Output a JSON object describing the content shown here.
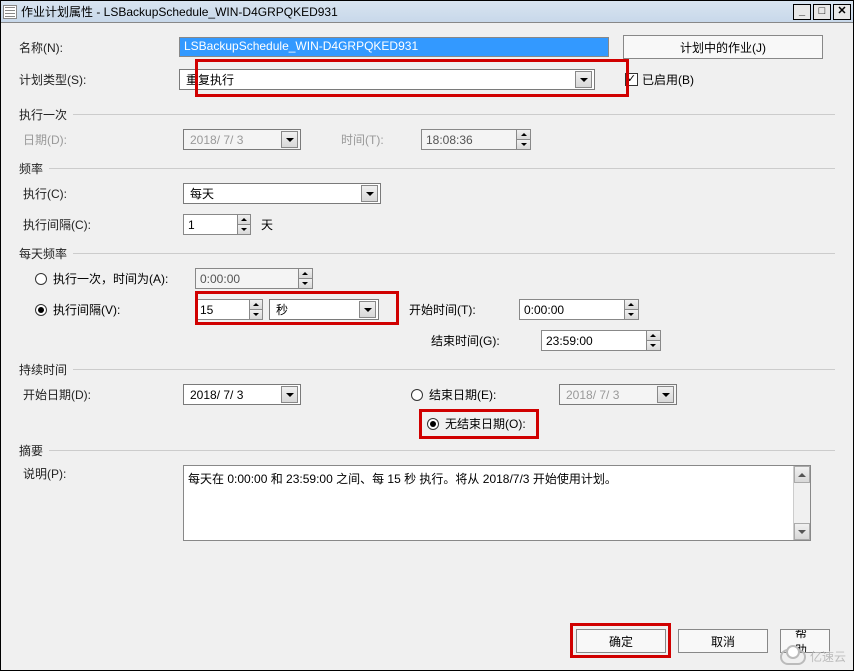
{
  "window": {
    "title": "作业计划属性 - LSBackupSchedule_WIN-D4GRPQKED931"
  },
  "labels": {
    "name": "名称(N):",
    "schedule_type": "计划类型(S):",
    "jobs_in_schedule": "计划中的作业(J)",
    "enabled": "已启用(B)",
    "once_section": "执行一次",
    "date": "日期(D):",
    "time": "时间(T):",
    "frequency_section": "频率",
    "execute": "执行(C):",
    "exec_interval": "执行间隔(C):",
    "interval_unit_day": "天",
    "daily_freq_section": "每天频率",
    "exec_once_at": "执行一次，时间为(A):",
    "exec_interval_v": "执行间隔(V):",
    "start_time": "开始时间(T):",
    "end_time": "结束时间(G):",
    "duration_section": "持续时间",
    "start_date": "开始日期(D):",
    "end_date": "结束日期(E):",
    "no_end_date": "无结束日期(O):",
    "summary_section": "摘要",
    "description": "说明(P):",
    "ok": "确定",
    "cancel": "取消",
    "help": "帮助"
  },
  "values": {
    "name": "LSBackupSchedule_WIN-D4GRPQKED931",
    "schedule_type": "重复执行",
    "enabled": true,
    "once_date": "2018/ 7/ 3",
    "once_time": "18:08:36",
    "execute": "每天",
    "exec_interval": "1",
    "daily_mode": "interval",
    "exec_once_time": "0:00:00",
    "interval_value": "15",
    "interval_unit": "秒",
    "start_time": "0:00:00",
    "end_time": "23:59:00",
    "start_date": "2018/ 7/ 3",
    "end_date_mode": "no_end",
    "end_date": "2018/ 7/ 3",
    "description": "每天在 0:00:00 和 23:59:00 之间、每 15 秒 执行。将从 2018/7/3 开始使用计划。"
  },
  "watermark": "亿速云"
}
